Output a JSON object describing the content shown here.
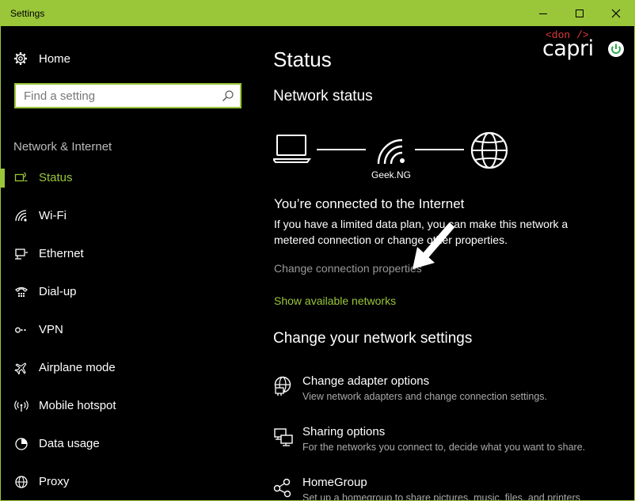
{
  "window": {
    "title": "Settings",
    "accent": "#9ac63a",
    "controls": [
      "minimize-icon",
      "maximize-icon",
      "close-icon"
    ]
  },
  "sidebar": {
    "home_label": "Home",
    "home_icon": "gear-icon",
    "search_placeholder": "Find a setting",
    "search_icon": "search-icon",
    "section_label": "Network & Internet",
    "items": [
      {
        "label": "Status",
        "icon": "status-icon",
        "active": true
      },
      {
        "label": "Wi-Fi",
        "icon": "wifi-icon"
      },
      {
        "label": "Ethernet",
        "icon": "ethernet-icon"
      },
      {
        "label": "Dial-up",
        "icon": "dialup-icon"
      },
      {
        "label": "VPN",
        "icon": "vpn-icon"
      },
      {
        "label": "Airplane mode",
        "icon": "airplane-icon"
      },
      {
        "label": "Mobile hotspot",
        "icon": "hotspot-icon"
      },
      {
        "label": "Data usage",
        "icon": "data-usage-icon"
      },
      {
        "label": "Proxy",
        "icon": "proxy-icon"
      }
    ]
  },
  "main": {
    "page_title": "Status",
    "network_status_heading": "Network status",
    "network_name": "Geek.NG",
    "connected_text": "You’re connected to the Internet",
    "description": "If you have a limited data plan, you can make this network a metered connection or change other properties.",
    "change_connection_link": "Change connection properties",
    "show_networks_link": "Show available networks",
    "change_settings_heading": "Change your network settings",
    "settings": [
      {
        "title": "Change adapter options",
        "subtitle": "View network adapters and change connection settings.",
        "icon": "adapter-icon"
      },
      {
        "title": "Sharing options",
        "subtitle": "For the networks you connect to, decide what you want to share.",
        "icon": "sharing-icon"
      },
      {
        "title": "HomeGroup",
        "subtitle": "Set up a homegroup to share pictures, music, files, and printers",
        "icon": "homegroup-icon"
      }
    ]
  },
  "watermark": {
    "tag": "<don />",
    "name": "capri",
    "tag_color": "#e23b3b"
  }
}
